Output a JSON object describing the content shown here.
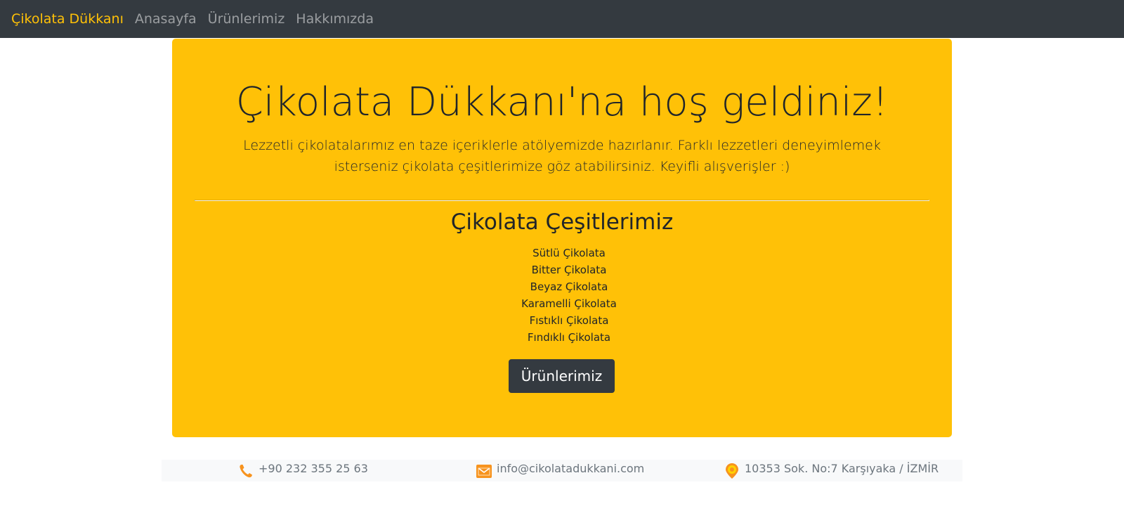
{
  "navbar": {
    "brand": "Çikolata Dükkanı",
    "links": [
      {
        "label": "Anasayfa"
      },
      {
        "label": "Ürünlerimiz"
      },
      {
        "label": "Hakkımızda"
      }
    ]
  },
  "hero": {
    "title": "Çikolata Dükkanı'na hoş geldiniz!",
    "lead": "Lezzetli çikolatalarımız en taze içeriklerle atölyemizde hazırlanır. Farklı lezzetleri deneyimlemek isterseniz çikolata çeşitlerimize göz atabilirsiniz. Keyifli alışverişler :)",
    "section_title": "Çikolata Çeşitlerimiz",
    "varieties": [
      "Sütlü Çikolata",
      "Bitter Çikolata",
      "Beyaz Çikolata",
      "Karamelli Çikolata",
      "Fıstıklı Çikolata",
      "Fındıklı Çikolata"
    ],
    "button_label": "Ürünlerimiz"
  },
  "contact": {
    "phone": {
      "icon": "phone-icon",
      "text": "+90 232 355 25 63"
    },
    "email": {
      "icon": "mail-icon",
      "text": "info@cikolatadukkani.com"
    },
    "address": {
      "icon": "location-pin-icon",
      "text": "10353 Sok. No:7 Karşıyaka / İZMİR"
    }
  },
  "colors": {
    "navbar_bg": "#343a40",
    "brand": "#ffc107",
    "hero_bg": "#ffc107",
    "button_bg": "#343a40",
    "icon_orange": "#f7931e"
  }
}
